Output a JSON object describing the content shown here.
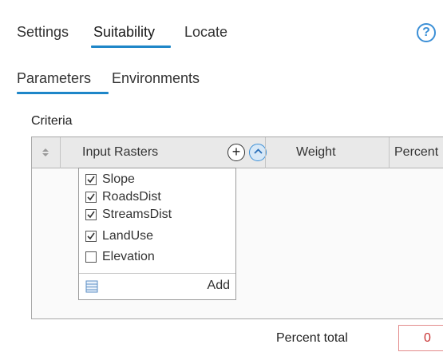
{
  "top_tabs": [
    {
      "label": "Settings",
      "active": false
    },
    {
      "label": "Suitability",
      "active": true
    },
    {
      "label": "Locate",
      "active": false
    }
  ],
  "help": {
    "glyph": "?",
    "icon": "help-circle-icon"
  },
  "sub_tabs": [
    {
      "label": "Parameters",
      "active": true
    },
    {
      "label": "Environments",
      "active": false
    }
  ],
  "criteria": {
    "label": "Criteria",
    "columns": [
      "Input Rasters",
      "Weight",
      "Percent"
    ],
    "add_glyph": "+",
    "raster_list": {
      "items": [
        {
          "label": "Slope",
          "checked": true
        },
        {
          "label": "RoadsDist",
          "checked": true
        },
        {
          "label": "StreamsDist",
          "checked": true
        },
        {
          "label": "LandUse",
          "checked": true
        },
        {
          "label": "Elevation",
          "checked": false
        }
      ],
      "add_label": "Add"
    }
  },
  "percent_total": {
    "label": "Percent total",
    "value": "0"
  },
  "colors": {
    "accent": "#1e86c8",
    "error": "#c83232"
  }
}
